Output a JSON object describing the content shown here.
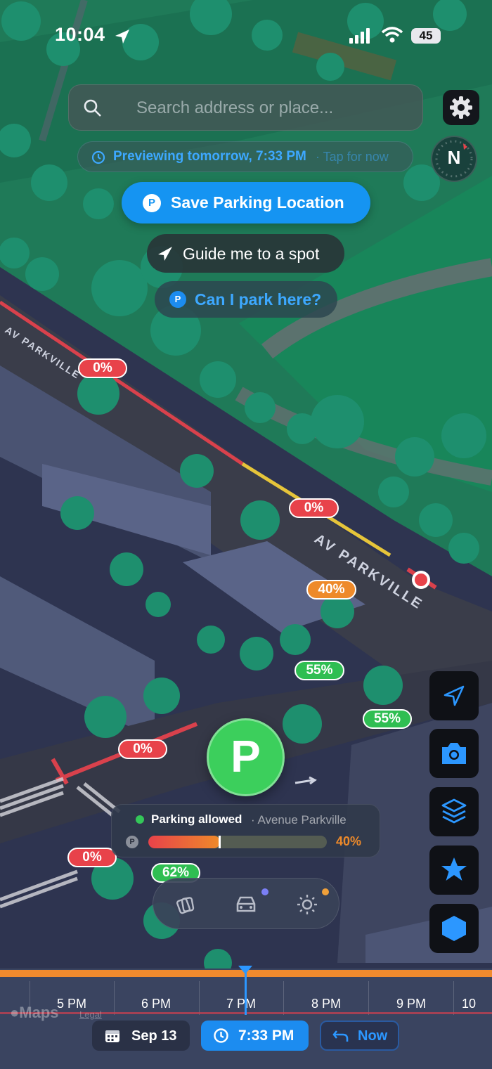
{
  "status_bar": {
    "time": "10:04",
    "battery": "45"
  },
  "search": {
    "placeholder": "Search address or place..."
  },
  "preview": {
    "main": "Previewing tomorrow, 7:33 PM",
    "sub": "· Tap for now"
  },
  "compass": {
    "label": "N"
  },
  "actions": {
    "save_parking": "Save Parking Location",
    "guide_me": "Guide me to a spot",
    "can_i_park": "Can I park here?"
  },
  "map": {
    "street_labels": [
      "AV PARKVILLE",
      "AV PARKVILLE"
    ],
    "occupancy_badges": [
      {
        "label": "0%",
        "level": "red"
      },
      {
        "label": "0%",
        "level": "red"
      },
      {
        "label": "40%",
        "level": "orange"
      },
      {
        "label": "55%",
        "level": "green"
      },
      {
        "label": "55%",
        "level": "green"
      },
      {
        "label": "0%",
        "level": "red"
      },
      {
        "label": "0%",
        "level": "red"
      },
      {
        "label": "62%",
        "level": "green"
      }
    ],
    "marker_label": "P"
  },
  "info_card": {
    "status": "Parking allowed",
    "street": "· Avenue Parkville",
    "p_icon": "P",
    "occupancy_percent": "40%",
    "occupancy_fraction": 0.4
  },
  "mode_bar": {
    "items": [
      {
        "icon": "layers-stack-icon"
      },
      {
        "icon": "car-icon",
        "dot_color": "#7b7ff5"
      },
      {
        "icon": "sun-icon",
        "dot_color": "#f0a03a"
      }
    ]
  },
  "side_buttons": [
    "location-arrow-icon",
    "camera-icon",
    "layers-icon",
    "star-icon",
    "hexagon-icon"
  ],
  "timeline": {
    "hours": [
      "5 PM",
      "6 PM",
      "7 PM",
      "8 PM",
      "9 PM",
      "10"
    ],
    "watermark": "Maps",
    "legal": "Legal"
  },
  "controls": {
    "date": "Sep 13",
    "time": "7:33 PM",
    "now": "Now"
  },
  "colors": {
    "accent": "#1594f2",
    "green": "#2fbe52",
    "red": "#e8424a",
    "orange": "#ee8a2a"
  }
}
